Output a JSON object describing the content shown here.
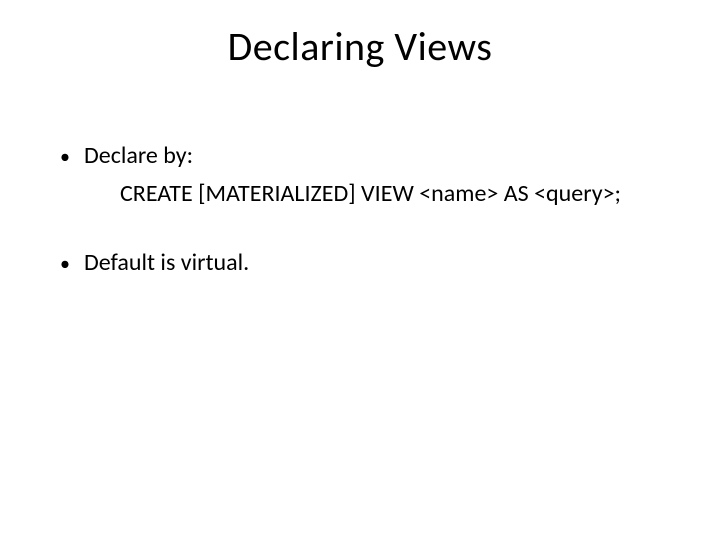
{
  "title": "Declaring Views",
  "bullets": [
    {
      "label": "Declare by:",
      "sub": "CREATE [MATERIALIZED] VIEW  <name>  AS  <query>;"
    },
    {
      "label": "Default is virtual."
    }
  ]
}
